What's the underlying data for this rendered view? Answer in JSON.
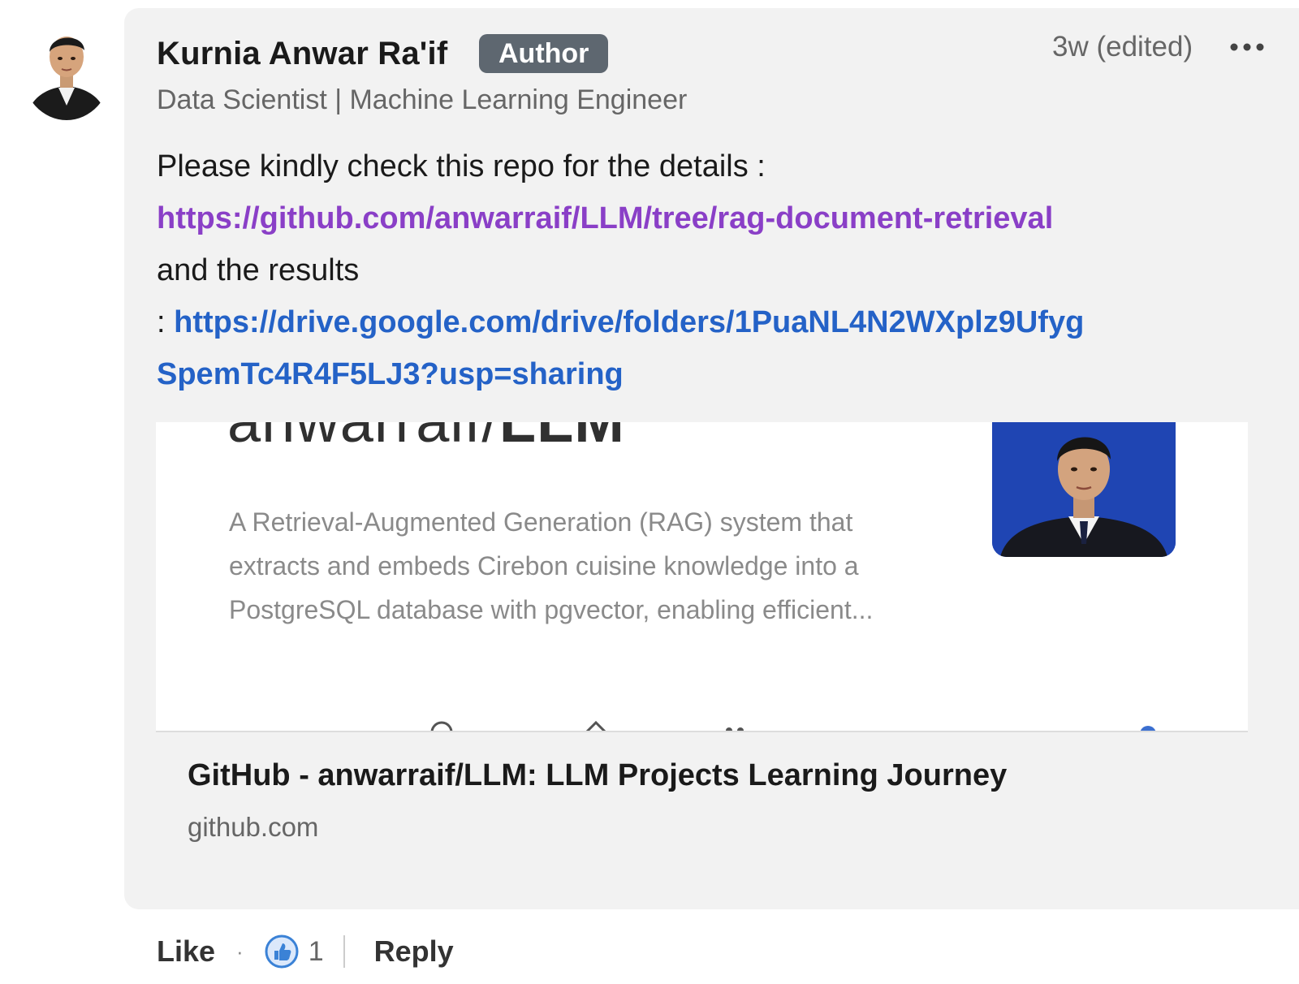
{
  "comment": {
    "author_name": "Kurnia Anwar Ra'if",
    "author_badge": "Author",
    "headline": "Data Scientist | Machine Learning Engineer",
    "timestamp": "3w (edited)",
    "more_icon": "ellipsis-icon",
    "body": {
      "line1": "Please kindly check this repo for the details :",
      "repo_link": "https://github.com/anwarraif/LLM/tree/rag-document-retrieval",
      "line3": "and the results",
      "results_prefix": ":",
      "drive_link_part1": "https://drive.google.com/drive/folders/1PuaNL4N2WXplz9Ufyg",
      "drive_link_part2": "SpemTc4R4F5LJ3?usp=sharing"
    }
  },
  "link_preview": {
    "og_title_regular": "anwarraif/",
    "og_title_bold": "LLM",
    "og_description": "A Retrieval-Augmented Generation (RAG) system that extracts and embeds Cirebon cuisine knowledge into a PostgreSQL database with pgvector, enabling efficient...",
    "title": "GitHub - anwarraif/LLM: LLM Projects Learning Journey",
    "domain": "github.com"
  },
  "actions": {
    "like_label": "Like",
    "separator": "·",
    "reaction_icon": "like-reaction-icon",
    "reaction_count": "1",
    "reply_label": "Reply"
  },
  "colors": {
    "bubble_bg": "#f2f2f2",
    "badge_bg": "#5e6770",
    "visited_link": "#8a3fc7",
    "link": "#2462c7",
    "reaction_blue": "#3b82d6"
  }
}
